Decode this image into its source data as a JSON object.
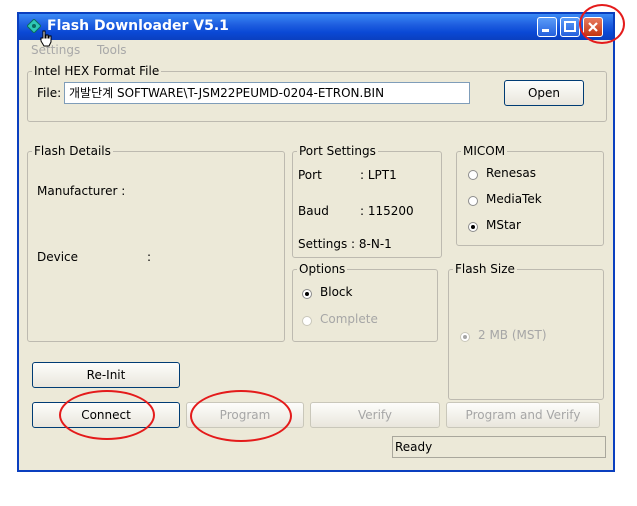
{
  "window": {
    "title": "Flash Downloader V5.1"
  },
  "menu": {
    "settings": "Settings",
    "tools": "Tools"
  },
  "hex_group": {
    "legend": "Intel HEX Format File",
    "file_label": "File:",
    "file_value": "개발단계 SOFTWARE\\T-JSM22PEUMD-0204-ETRON.BIN",
    "open_button": "Open"
  },
  "flash_details": {
    "legend": "Flash Details",
    "manufacturer_label": "Manufacturer :",
    "device_label": "Device",
    "device_colon": ":"
  },
  "port_settings": {
    "legend": "Port Settings",
    "port_label": "Port",
    "port_value": ": LPT1",
    "baud_label": "Baud",
    "baud_value": ": 115200",
    "settings_label": "Settings : 8-N-1"
  },
  "micom": {
    "legend": "MICOM",
    "options": [
      "Renesas",
      "MediaTek",
      "MStar"
    ],
    "selected": "MStar"
  },
  "options_group": {
    "legend": "Options",
    "block": "Block",
    "complete": "Complete",
    "selected": "Block"
  },
  "flash_size": {
    "legend": "Flash Size",
    "option": "2 MB (MST)"
  },
  "buttons": {
    "reinit": "Re-Init",
    "connect": "Connect",
    "program": "Program",
    "verify": "Verify",
    "program_verify": "Program and Verify"
  },
  "status": "Ready",
  "colors": {
    "annotation": "#e41b1b",
    "titlebar": "#0a49d6"
  }
}
